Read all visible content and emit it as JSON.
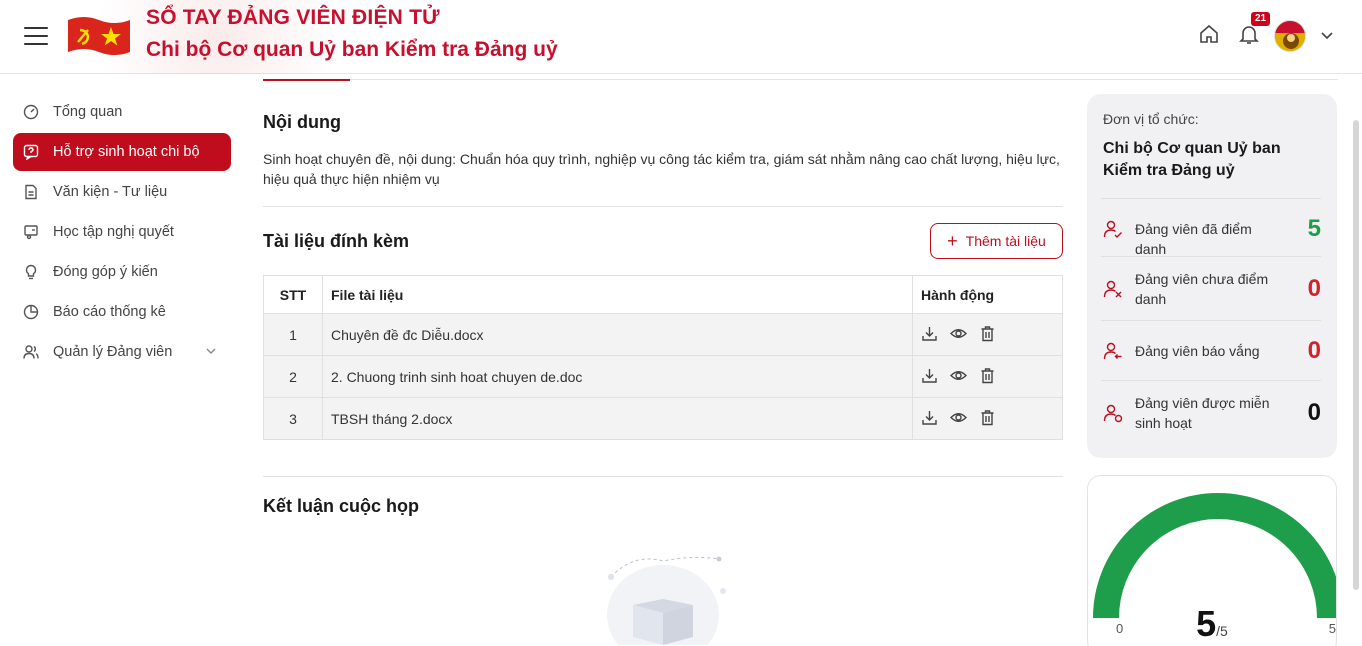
{
  "header": {
    "title": "SỔ TAY ĐẢNG VIÊN ĐIỆN TỬ",
    "subtitle": "Chi bộ Cơ quan Uỷ ban Kiểm tra Đảng uỷ",
    "notification_count": "21",
    "icons": [
      "menu-icon",
      "flag-logo",
      "home-icon",
      "bell-icon",
      "avatar",
      "chevron-down-icon"
    ]
  },
  "sidebar": {
    "items": [
      {
        "label": "Tổng quan",
        "icon": "dashboard-icon",
        "active": false
      },
      {
        "label": "Hỗ trợ sinh hoạt chi bộ",
        "icon": "help-chat-icon",
        "active": true
      },
      {
        "label": "Văn kiện - Tư liệu",
        "icon": "document-icon",
        "active": false
      },
      {
        "label": "Học tập nghị quyết",
        "icon": "study-icon",
        "active": false
      },
      {
        "label": "Đóng góp ý kiến",
        "icon": "lightbulb-icon",
        "active": false
      },
      {
        "label": "Báo cáo thống kê",
        "icon": "pie-chart-icon",
        "active": false
      },
      {
        "label": "Quản lý Đảng viên",
        "icon": "users-icon",
        "active": false,
        "expandable": true
      }
    ]
  },
  "main": {
    "content_title": "Nội dung",
    "content_text": "Sinh hoạt chuyên đề, nội dung: Chuẩn hóa quy trình, nghiệp vụ công tác kiểm tra, giám sát nhằm nâng cao chất lượng, hiệu lực, hiệu quả thực hiện nhiệm vụ",
    "attachments_title": "Tài liệu đính kèm",
    "add_button": "Thêm tài liệu",
    "table": {
      "headers": [
        "STT",
        "File tài liệu",
        "Hành động"
      ],
      "rows": [
        {
          "stt": "1",
          "file": "Chuyên đề đc Diễu.docx"
        },
        {
          "stt": "2",
          "file": "2. Chuong trinh sinh hoat chuyen de.doc"
        },
        {
          "stt": "3",
          "file": "TBSH tháng 2.docx"
        }
      ],
      "actions": [
        "download-icon",
        "view-icon",
        "delete-icon"
      ]
    },
    "conclusion_title": "Kết luận cuộc họp"
  },
  "stats": {
    "org_label": "Đơn vị tổ chức:",
    "org_name": "Chi bộ Cơ quan Uỷ ban Kiểm tra Đảng uỷ",
    "rows": [
      {
        "label": "Đảng viên đã điểm danh",
        "value": "5",
        "color": "#1e9e4a",
        "icon": "user-check-icon"
      },
      {
        "label": "Đảng viên chưa điểm danh",
        "value": "0",
        "color": "#d2232a",
        "icon": "user-x-icon"
      },
      {
        "label": "Đảng viên báo vắng",
        "value": "0",
        "color": "#d2232a",
        "icon": "user-arrow-icon"
      },
      {
        "label": "Đảng viên được miễn sinh hoạt",
        "value": "0",
        "color": "#111111",
        "icon": "user-exempt-icon"
      }
    ]
  },
  "gauge": {
    "value": "5",
    "total": "/5",
    "min_label": "0",
    "max_label": "5",
    "fraction": 1.0,
    "color": "#1e9e4a"
  },
  "colors": {
    "brand": "#c00d1e",
    "accent_green": "#1e9e4a"
  }
}
